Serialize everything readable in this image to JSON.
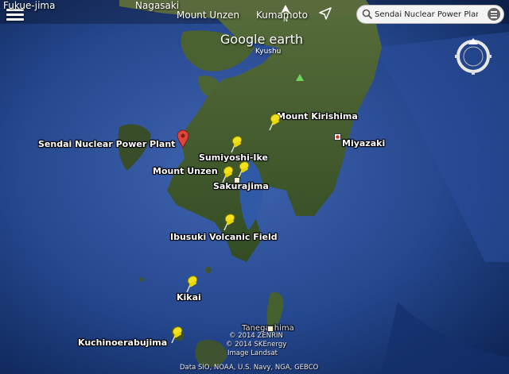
{
  "top_labels": {
    "fukue": "Fukue-jima",
    "nagasaki": "Nagasaki",
    "mount_unzen": "Mount Unzen",
    "kumamoto": "Kumamoto"
  },
  "search": {
    "value": "Sendai Nuclear Power Plant, Sats..."
  },
  "brand": {
    "logo": "Google earth",
    "region": "Kyushu"
  },
  "places": {
    "mount_kirishima": "Mount Kirishima",
    "miyazaki": "Miyazaki",
    "sendai_npp": "Sendai Nuclear Power Plant",
    "sumiyoshi": "Sumiyoshi-Ike",
    "mount_unzen": "Mount Unzen",
    "sakurajima": "Sakurajima",
    "ibusuki": "Ibusuki Volcanic Field",
    "kikai": "Kikai",
    "tanegashima": "Tanegashima",
    "kuchinoerabujima": "Kuchinoerabujima"
  },
  "credits": {
    "line1": "© 2014 ZENRIN",
    "line2": "© 2014 SKEnergy",
    "line3": "Image Landsat",
    "line4": "Data SIO, NOAA, U.S. Navy, NGA, GEBCO"
  },
  "icons": {
    "menu": "menu-icon",
    "north": "north-arrow-icon",
    "locate": "location-arrow-icon",
    "search": "search-icon",
    "list": "list-icon",
    "compass": "compass-icon",
    "pin": "yellow-pushpin-icon",
    "marker": "red-marker-icon"
  },
  "colors": {
    "ocean_deep": "#0b2a5e",
    "ocean_shallow": "#3f64b0",
    "land": "#3f5a2a",
    "pin": "#f2e21d",
    "marker": "#e0453a"
  }
}
